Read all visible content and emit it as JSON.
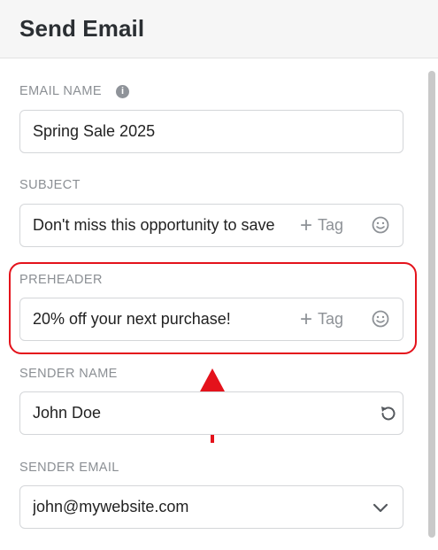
{
  "header": {
    "title": "Send Email"
  },
  "fields": {
    "email_name": {
      "label": "EMAIL NAME",
      "value": "Spring Sale 2025"
    },
    "subject": {
      "label": "SUBJECT",
      "value": "Don't miss this opportunity to save",
      "tag_label": "Tag"
    },
    "preheader": {
      "label": "PREHEADER",
      "value": "20% off your next purchase!",
      "tag_label": "Tag"
    },
    "sender_name": {
      "label": "SENDER NAME",
      "value": "John Doe"
    },
    "sender_email": {
      "label": "SENDER EMAIL",
      "value": "john@mywebsite.com"
    }
  },
  "icons": {
    "info": "info-icon",
    "emoji": "emoji-icon",
    "reset": "reset-icon",
    "dropdown": "chevron-down-icon",
    "tag_plus": "plus-icon"
  },
  "colors": {
    "highlight": "#e4121b",
    "label": "#8b8f94",
    "border": "#d4d6d9"
  }
}
